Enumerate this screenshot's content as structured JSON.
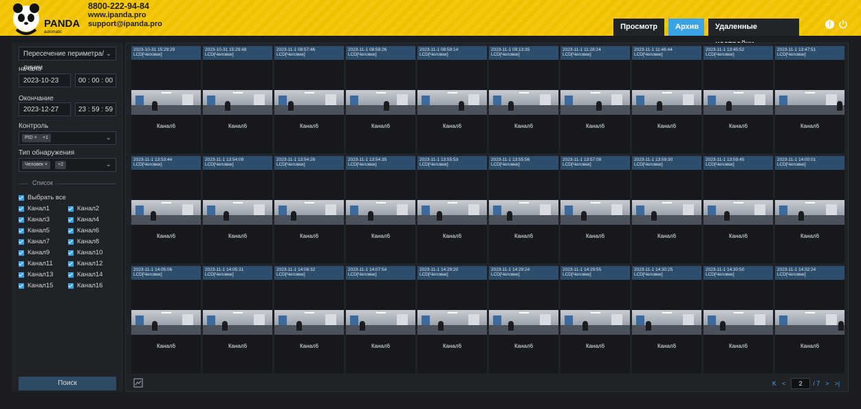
{
  "header": {
    "logo_text": "PANDA",
    "logo_sub": "automatic",
    "phone": "8800-222-94-84",
    "site": "www.ipanda.pro",
    "email": "support@ipanda.pro",
    "tabs": [
      {
        "label": "Просмотр",
        "active": false
      },
      {
        "label": "Архив",
        "active": true
      },
      {
        "label": "Удаленные настройки",
        "active": false
      }
    ],
    "icons": [
      "warning-icon",
      "power-icon"
    ]
  },
  "sidebar": {
    "event_type": "Пересечение периметра/линии",
    "start_label": "начало",
    "start_date": "2023-10-23",
    "start_time": "00 : 00 : 00",
    "end_label": "Окончание",
    "end_date": "2023-12-27",
    "end_time": "23 : 59 : 59",
    "control_label": "Контроль",
    "control_tags": [
      "PID",
      "+1"
    ],
    "detect_label": "Тип обнаружения",
    "detect_tags": [
      "Человек",
      "+2"
    ],
    "list_label": "Список",
    "select_all": "Выбрать все",
    "channels": [
      "Канал1",
      "Канал2",
      "Канал3",
      "Канал4",
      "Канал5",
      "Канал6",
      "Канал7",
      "Канал8",
      "Канал9",
      "Канал10",
      "Канал11",
      "Канал12",
      "Канал13",
      "Канал14",
      "Канал15",
      "Канал16"
    ],
    "search_label": "Поиск"
  },
  "results": {
    "type_text": "LCD[Человек]",
    "channel_text": "Канал6",
    "timestamps": [
      "2023-10-31 15:29:29",
      "2023-10-31 15:29:48",
      "2023-11-1 08:57:46",
      "2023-11-1 08:58:26",
      "2023-11-1 08:59:14",
      "2023-11-1 09:13:35",
      "2023-11-1 11:28:24",
      "2023-11-1 11:46:44",
      "2023-11-1 13:45:52",
      "2023-11-1 13:47:51",
      "2023-11-1 13:53:44",
      "2023-11-1 13:54:09",
      "2023-11-1 13:54:28",
      "2023-11-1 13:54:35",
      "2023-11-1 13:55:53",
      "2023-11-1 13:55:56",
      "2023-11-1 13:57:09",
      "2023-11-1 13:59:30",
      "2023-11-1 13:59:45",
      "2023-11-1 14:00:01",
      "2023-11-1 14:05:06",
      "2023-11-1 14:05:31",
      "2023-11-1 14:06:32",
      "2023-11-1 14:07:54",
      "2023-11-1 14:29:20",
      "2023-11-1 14:29:24",
      "2023-11-1 14:29:55",
      "2023-11-1 14:30:25",
      "2023-11-1 14:30:50",
      "2023-11-1 14:32:24"
    ]
  },
  "pager": {
    "first": "K",
    "prev": "<",
    "current": "2",
    "total": "/ 7",
    "next": ">",
    "last": ">|"
  }
}
